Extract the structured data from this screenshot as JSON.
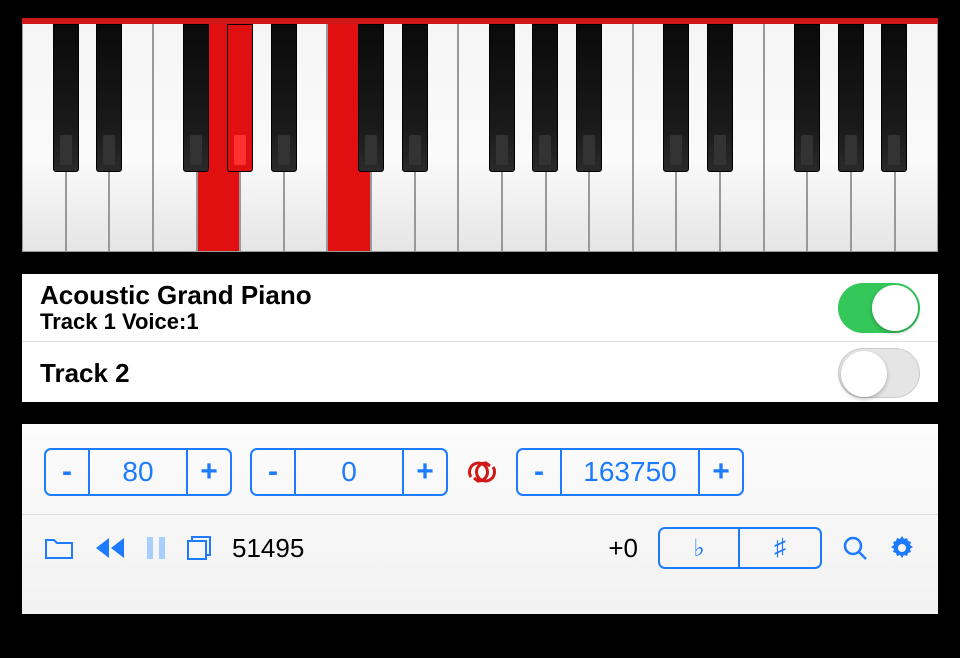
{
  "tracks": [
    {
      "title": "Acoustic Grand Piano",
      "subtitle": "Track 1 Voice:1",
      "enabled": true
    },
    {
      "title": "Track 2",
      "subtitle": "",
      "enabled": false
    }
  ],
  "steppers": {
    "tempo": "80",
    "transpose": "0",
    "position_end": "163750"
  },
  "toolbar": {
    "position": "51495",
    "offset": "+0",
    "flat_label": "♭",
    "sharp_label": "♯"
  },
  "icons": {
    "minus": "-",
    "plus": "+"
  },
  "piano": {
    "pressed_white": [
      4,
      7
    ],
    "pressed_black": [
      3
    ]
  }
}
